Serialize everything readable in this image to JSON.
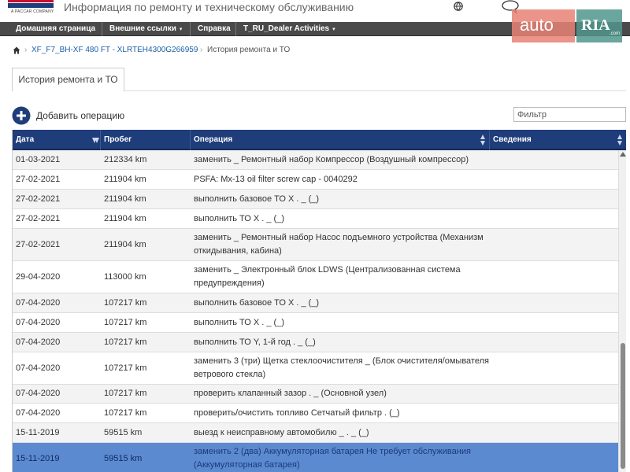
{
  "header": {
    "logo_text": "DAF",
    "logo_sub": "A PACCAR COMPANY",
    "app_title": "Информация по ремонту и техническому обслуживанию",
    "brand_color": "#1f3d7a"
  },
  "watermark": {
    "left": "auto",
    "right": "RIA",
    "domain": ".com"
  },
  "nav": {
    "items": [
      {
        "label": "Домашняя страница"
      },
      {
        "label": "Внешние ссылки",
        "caret": "▾"
      },
      {
        "label": "Справка"
      },
      {
        "label": "T_RU_Dealer Activities",
        "caret": "▾"
      }
    ]
  },
  "breadcrumb": {
    "sep": "›",
    "link": "XF_F7_BH-XF 480 FT - XLRTEH4300G266959",
    "current": "История ремонта и ТО"
  },
  "tab": {
    "label": "История ремонта и ТО"
  },
  "toolbar": {
    "add_label": "Добавить операцию",
    "filter_placeholder": "Фильтр"
  },
  "table": {
    "columns": [
      "Дата",
      "Пробег",
      "Операция",
      "Сведения"
    ],
    "header_color": "#1f3d7a",
    "selected_color": "#5b8ad1",
    "rows": [
      {
        "date": "01-03-2021",
        "km": "212334 km",
        "op": "заменить _ Ремонтный набор Компрессор (Воздушный компрессор)",
        "info": ""
      },
      {
        "date": "27-02-2021",
        "km": "211904 km",
        "op": "PSFA: Mx-13 oil filter screw cap - 0040292",
        "info": ""
      },
      {
        "date": "27-02-2021",
        "km": "211904 km",
        "op": "выполнить базовое ТО X . _ (_)",
        "info": ""
      },
      {
        "date": "27-02-2021",
        "km": "211904 km",
        "op": "выполнить ТО X . _ (_)",
        "info": ""
      },
      {
        "date": "27-02-2021",
        "km": "211904 km",
        "op": "заменить _ Ремонтный набор Насос подъемного устройства (Механизм откидывания, кабина)",
        "info": ""
      },
      {
        "date": "29-04-2020",
        "km": "113000 km",
        "op": "заменить _ Электронный блок LDWS (Централизованная система предупреждения)",
        "info": ""
      },
      {
        "date": "07-04-2020",
        "km": "107217 km",
        "op": "выполнить базовое ТО X . _ (_)",
        "info": ""
      },
      {
        "date": "07-04-2020",
        "km": "107217 km",
        "op": "выполнить ТО X . _ (_)",
        "info": ""
      },
      {
        "date": "07-04-2020",
        "km": "107217 km",
        "op": "выполнить ТО Y, 1-й год . _ (_)",
        "info": ""
      },
      {
        "date": "07-04-2020",
        "km": "107217 km",
        "op": "заменить 3 (три) Щетка стеклоочистителя _ (Блок очистителя/омывателя ветрового стекла)",
        "info": ""
      },
      {
        "date": "07-04-2020",
        "km": "107217 km",
        "op": "проверить клапанный зазор . _ (Основной узел)",
        "info": ""
      },
      {
        "date": "07-04-2020",
        "km": "107217 km",
        "op": "проверить/очистить топливо Сетчатый фильтр . (_)",
        "info": ""
      },
      {
        "date": "15-11-2019",
        "km": "59515 km",
        "op": "выезд к неисправному автомобилю _ . _ (_)",
        "info": ""
      },
      {
        "date": "15-11-2019",
        "km": "59515 km",
        "op": "заменить 2 (два) Аккумуляторная батарея Не требует обслуживания (Аккумуляторная батарея)",
        "info": ""
      }
    ]
  }
}
